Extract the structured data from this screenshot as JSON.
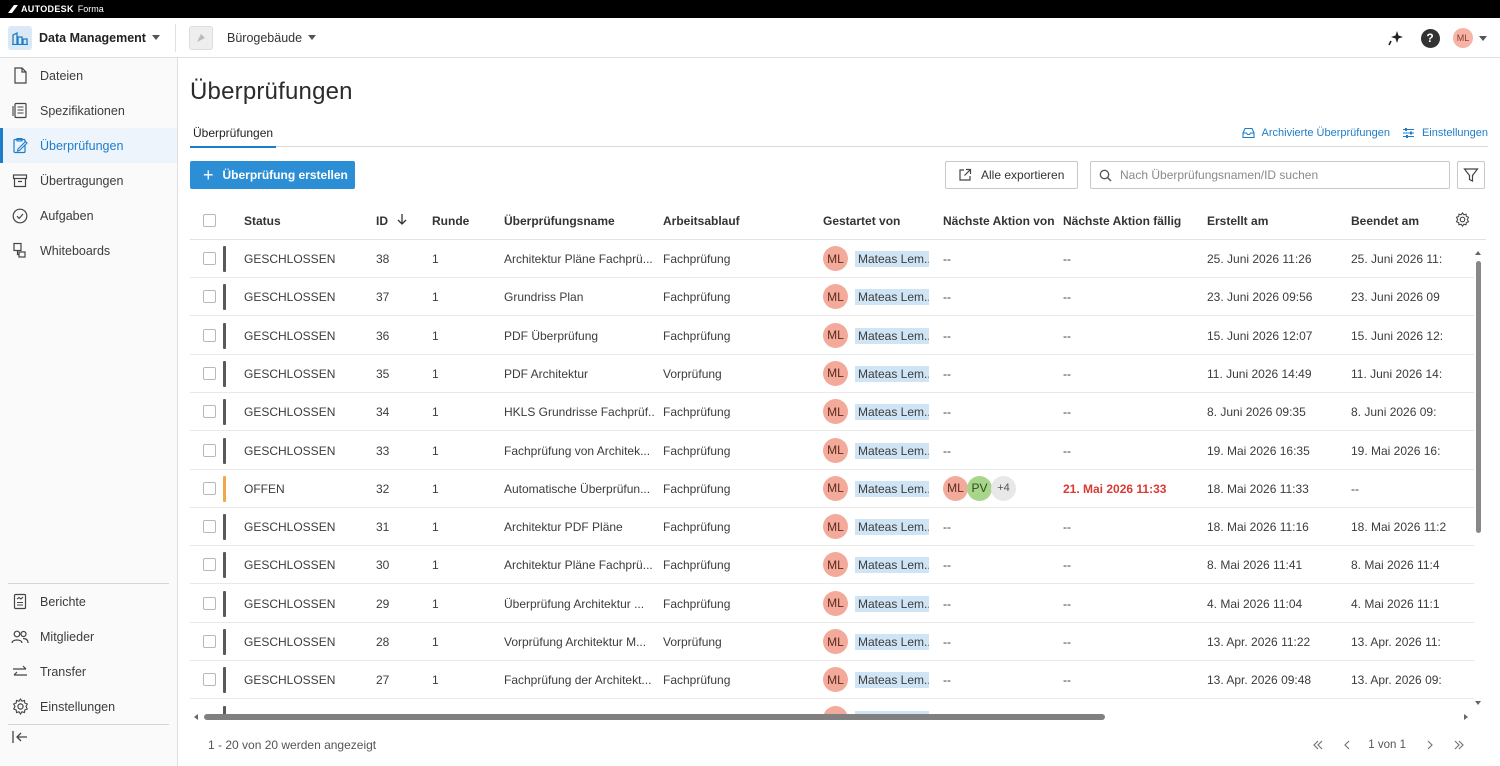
{
  "topbar": {
    "brand": "AUTODESK",
    "product": "Forma"
  },
  "header": {
    "app_name": "Data Management",
    "project_name": "Bürogebäude",
    "user_initials": "ML"
  },
  "sidebar": {
    "items": [
      {
        "label": "Dateien",
        "icon": "file-icon"
      },
      {
        "label": "Spezifikationen",
        "icon": "spec-icon"
      },
      {
        "label": "Überprüfungen",
        "icon": "review-icon",
        "active": true
      },
      {
        "label": "Übertragungen",
        "icon": "transmittal-icon"
      },
      {
        "label": "Aufgaben",
        "icon": "check-circle-icon"
      },
      {
        "label": "Whiteboards",
        "icon": "whiteboard-icon"
      }
    ],
    "bottom_items": [
      {
        "label": "Berichte",
        "icon": "report-icon"
      },
      {
        "label": "Mitglieder",
        "icon": "members-icon"
      },
      {
        "label": "Transfer",
        "icon": "transfer-icon"
      },
      {
        "label": "Einstellungen",
        "icon": "settings-icon"
      }
    ]
  },
  "page": {
    "title": "Überprüfungen",
    "tab": "Überprüfungen",
    "archived_link": "Archivierte Überprüfungen",
    "settings_link": "Einstellungen",
    "create_button": "Überprüfung erstellen",
    "export_button": "Alle exportieren",
    "search_placeholder": "Nach Überprüfungsnamen/ID suchen"
  },
  "table": {
    "columns": {
      "status": "Status",
      "id": "ID",
      "round": "Runde",
      "name": "Überprüfungsname",
      "workflow": "Arbeitsablauf",
      "started_by": "Gestartet von",
      "next_action_by": "Nächste Aktion von",
      "next_action_due": "Nächste Aktion fällig",
      "created": "Erstellt am",
      "finished": "Beendet am"
    },
    "rows": [
      {
        "status": "GESCHLOSSEN",
        "id": "38",
        "round": "1",
        "name": "Architektur Pläne Fachprü...",
        "workflow": "Fachprüfung",
        "started_initials": "ML",
        "started_name": "Mateas Lem...",
        "next_by": "--",
        "due": "--",
        "created": "25. Juni 2026 11:26",
        "finished": "25. Juni 2026 11:"
      },
      {
        "status": "GESCHLOSSEN",
        "id": "37",
        "round": "1",
        "name": "Grundriss Plan",
        "workflow": "Fachprüfung",
        "started_initials": "ML",
        "started_name": "Mateas Lem...",
        "next_by": "--",
        "due": "--",
        "created": "23. Juni 2026 09:56",
        "finished": "23. Juni 2026 09"
      },
      {
        "status": "GESCHLOSSEN",
        "id": "36",
        "round": "1",
        "name": "PDF Überprüfung",
        "workflow": "Fachprüfung",
        "started_initials": "ML",
        "started_name": "Mateas Lem...",
        "next_by": "--",
        "due": "--",
        "created": "15. Juni 2026 12:07",
        "finished": "15. Juni 2026 12:"
      },
      {
        "status": "GESCHLOSSEN",
        "id": "35",
        "round": "1",
        "name": "PDF Architektur",
        "workflow": "Vorprüfung",
        "started_initials": "ML",
        "started_name": "Mateas Lem...",
        "next_by": "--",
        "due": "--",
        "created": "11. Juni 2026 14:49",
        "finished": "11. Juni 2026 14:"
      },
      {
        "status": "GESCHLOSSEN",
        "id": "34",
        "round": "1",
        "name": "HKLS Grundrisse Fachprüf...",
        "workflow": "Fachprüfung",
        "started_initials": "ML",
        "started_name": "Mateas Lem...",
        "next_by": "--",
        "due": "--",
        "created": "8. Juni 2026 09:35",
        "finished": "8. Juni 2026 09:"
      },
      {
        "status": "GESCHLOSSEN",
        "id": "33",
        "round": "1",
        "name": "Fachprüfung von Architek...",
        "workflow": "Fachprüfung",
        "started_initials": "ML",
        "started_name": "Mateas Lem...",
        "next_by": "--",
        "due": "--",
        "created": "19. Mai 2026 16:35",
        "finished": "19. Mai 2026 16:"
      },
      {
        "status": "OFFEN",
        "id": "32",
        "round": "1",
        "name": "Automatische Überprüfun...",
        "workflow": "Fachprüfung",
        "started_initials": "ML",
        "started_name": "Mateas Lem...",
        "next_by": "",
        "next_avatars": [
          "ML",
          "PV"
        ],
        "next_more": "+4",
        "due": "21. Mai 2026 11:33",
        "created": "18. Mai 2026 11:33",
        "finished": "--"
      },
      {
        "status": "GESCHLOSSEN",
        "id": "31",
        "round": "1",
        "name": "Architektur PDF Pläne",
        "workflow": "Fachprüfung",
        "started_initials": "ML",
        "started_name": "Mateas Lem...",
        "next_by": "--",
        "due": "--",
        "created": "18. Mai 2026 11:16",
        "finished": "18. Mai 2026 11:2"
      },
      {
        "status": "GESCHLOSSEN",
        "id": "30",
        "round": "1",
        "name": "Architektur Pläne Fachprü...",
        "workflow": "Fachprüfung",
        "started_initials": "ML",
        "started_name": "Mateas Lem...",
        "next_by": "--",
        "due": "--",
        "created": "8. Mai 2026 11:41",
        "finished": "8. Mai 2026 11:4"
      },
      {
        "status": "GESCHLOSSEN",
        "id": "29",
        "round": "1",
        "name": "Überprüfung Architektur ...",
        "workflow": "Fachprüfung",
        "started_initials": "ML",
        "started_name": "Mateas Lem...",
        "next_by": "--",
        "due": "--",
        "created": "4. Mai 2026 11:04",
        "finished": "4. Mai 2026 11:1"
      },
      {
        "status": "GESCHLOSSEN",
        "id": "28",
        "round": "1",
        "name": "Vorprüfung Architektur M...",
        "workflow": "Vorprüfung",
        "started_initials": "ML",
        "started_name": "Mateas Lem...",
        "next_by": "--",
        "due": "--",
        "created": "13. Apr. 2026 11:22",
        "finished": "13. Apr. 2026 11:"
      },
      {
        "status": "GESCHLOSSEN",
        "id": "27",
        "round": "1",
        "name": "Fachprüfung der Architekt...",
        "workflow": "Fachprüfung",
        "started_initials": "ML",
        "started_name": "Mateas Lem...",
        "next_by": "--",
        "due": "--",
        "created": "13. Apr. 2026 09:48",
        "finished": "13. Apr. 2026 09:"
      }
    ]
  },
  "footer": {
    "count_text": "1 - 20 von 20 werden angezeigt",
    "page_text": "1 von 1"
  },
  "colors": {
    "accent": "#1e7dc8",
    "primary_button": "#2c8fd6",
    "closed_bar": "#595959",
    "open_bar": "#f0a848",
    "due_red": "#d93a32"
  }
}
